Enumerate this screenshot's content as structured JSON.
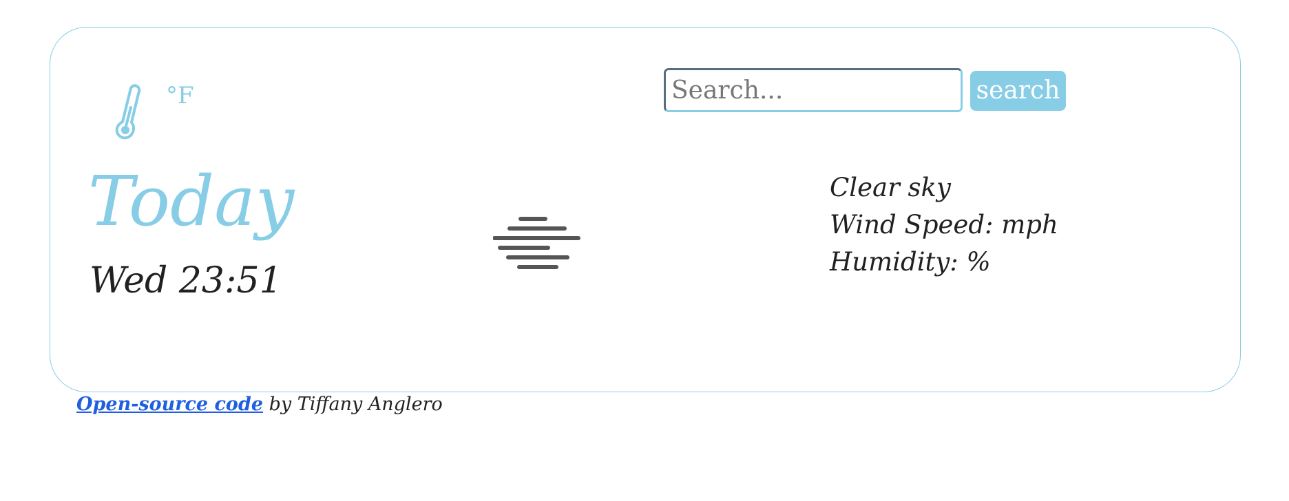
{
  "header": {
    "unit_label": "°F",
    "thermometer_icon": "thermometer-icon"
  },
  "search": {
    "placeholder": "Search...",
    "value": "",
    "button_label": "search"
  },
  "current": {
    "day_label": "Today",
    "datetime": "Wed 23:51",
    "weather_icon": "mist-icon",
    "description": "Clear sky",
    "wind_label": "Wind Speed: mph",
    "humidity_label": "Humidity: %"
  },
  "footer": {
    "link_text": "Open-source code",
    "suffix_text": " by Tiffany Anglero"
  },
  "colors": {
    "accent": "#87cde6",
    "text": "#212121",
    "link": "#1f5fe0"
  }
}
